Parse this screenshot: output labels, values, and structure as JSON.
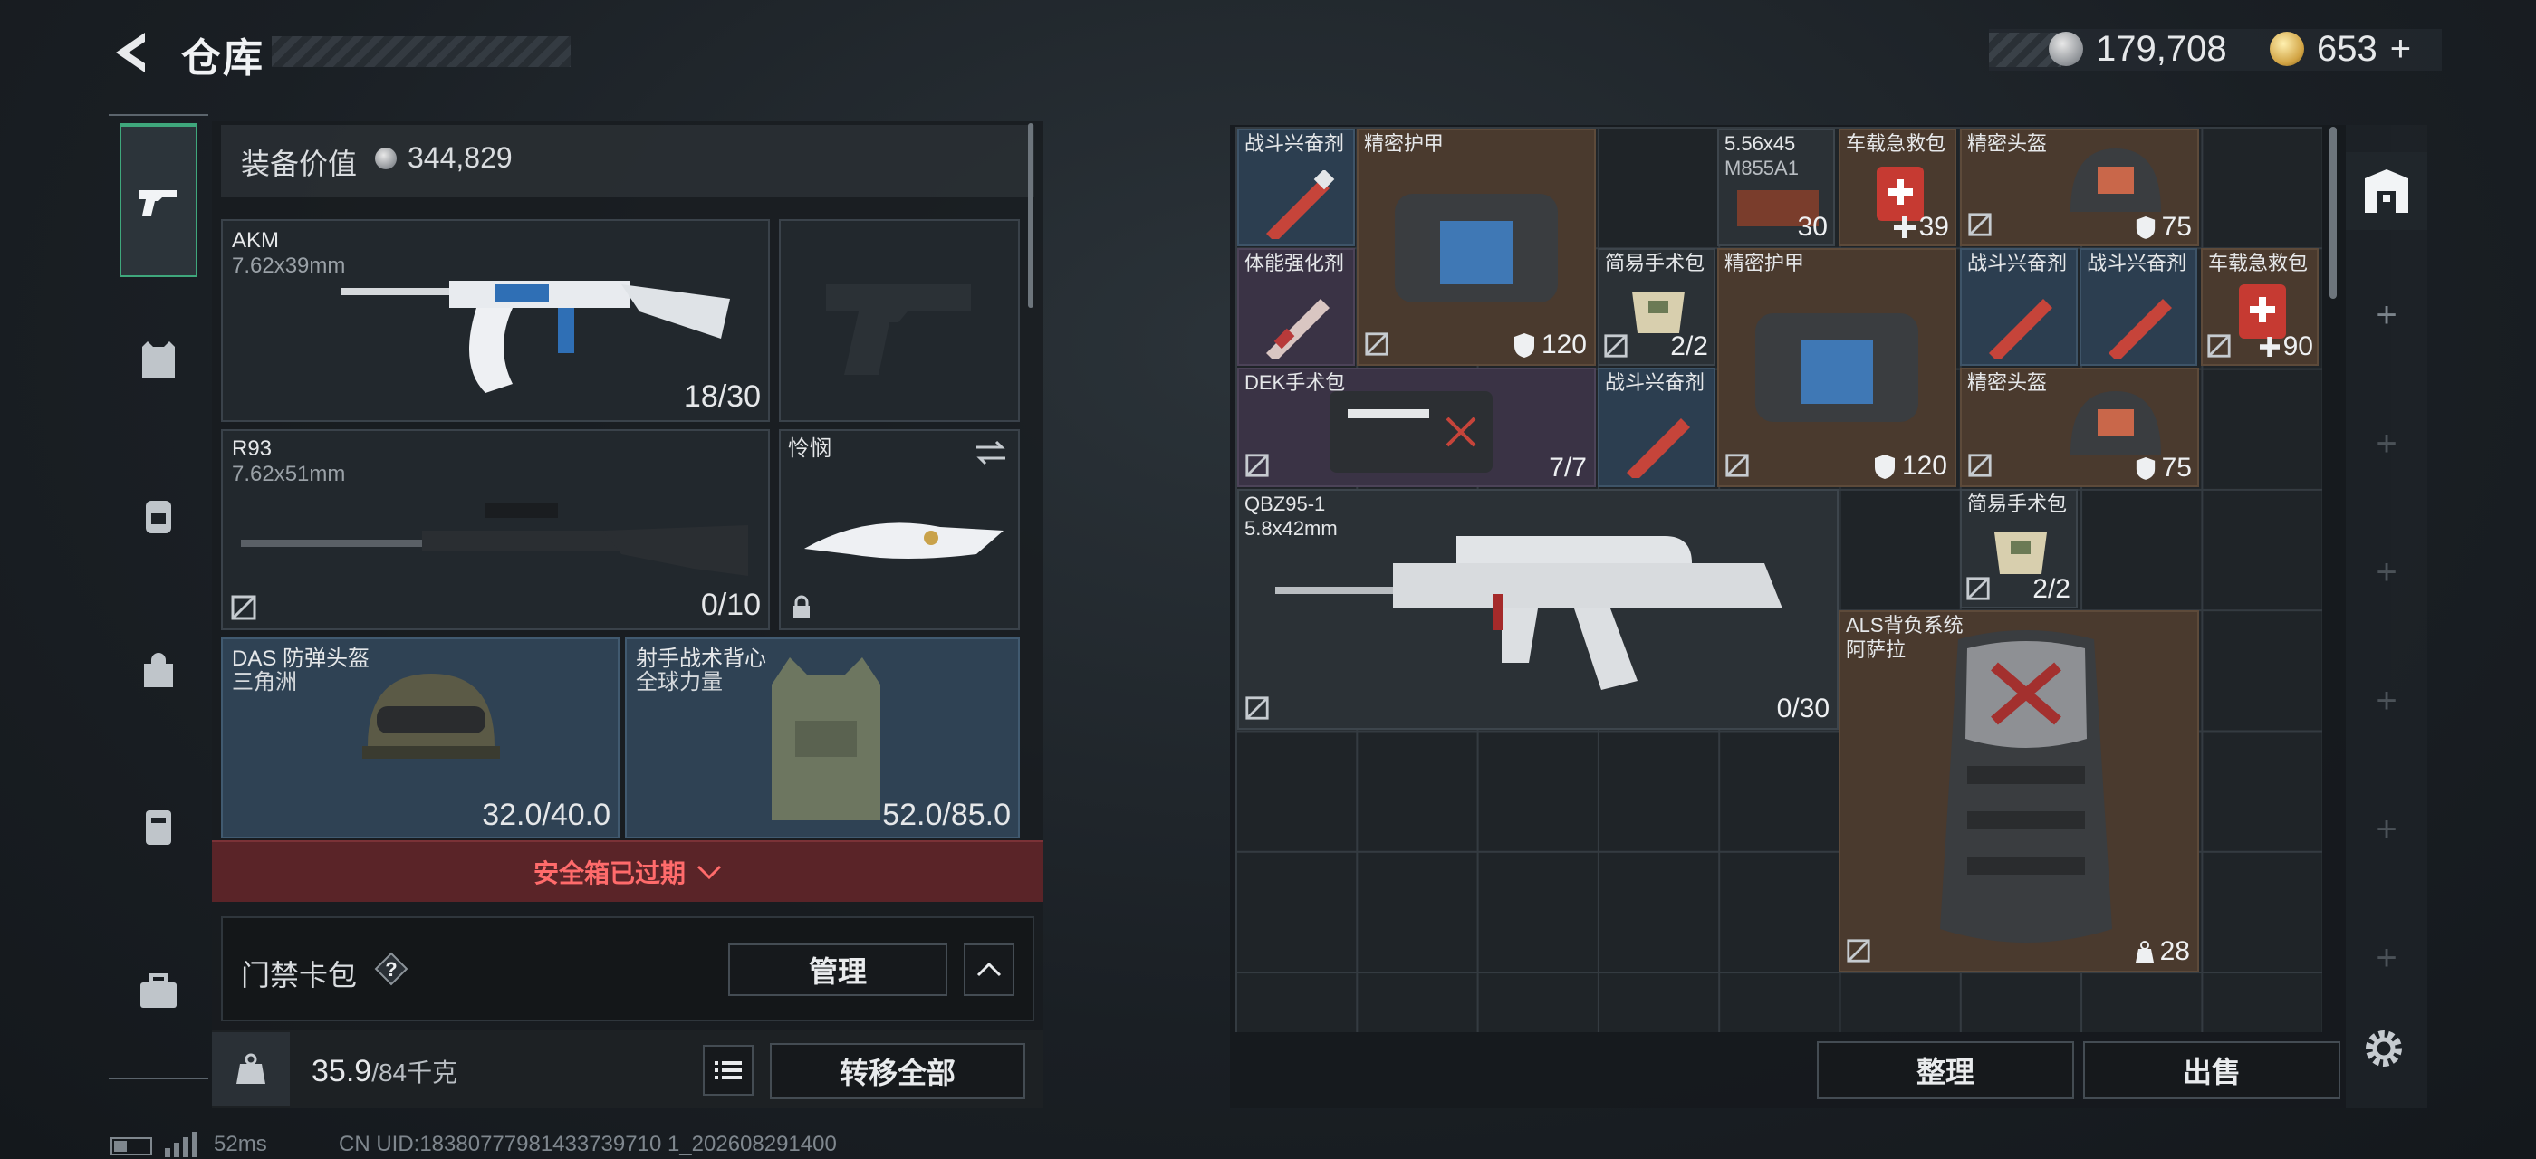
{
  "header": {
    "title": "仓库",
    "currency_silver": "179,708",
    "currency_gold": "653",
    "gold_plus": "+"
  },
  "equipment": {
    "value_label": "装备价值",
    "value": "344,829",
    "slots": [
      {
        "name": "AKM",
        "sub": "7.62x39mm",
        "count": "18/30"
      },
      {
        "name": "R93",
        "sub": "7.62x51mm",
        "count": "0/10"
      },
      {
        "name": "怜悯",
        "sub": "",
        "count": ""
      },
      {
        "name": "DAS 防弹头盔",
        "sub": "三角洲",
        "count": "32.0/40.0"
      },
      {
        "name": "射手战术背心",
        "sub": "全球力量",
        "count": "52.0/85.0"
      }
    ],
    "alert": "安全箱已过期",
    "keycard_label": "门禁卡包",
    "help": "?",
    "manage": "管理",
    "weight_current": "35.9",
    "weight_cap": "/84千克",
    "transfer_all": "转移全部"
  },
  "storage": {
    "items": [
      {
        "name": "战斗兴奋剂",
        "value": ""
      },
      {
        "name": "精密护甲",
        "value": "120"
      },
      {
        "name": "5.56x45",
        "sub": "M855A1",
        "value": "30"
      },
      {
        "name": "车载急救包",
        "value": "39"
      },
      {
        "name": "精密头盔",
        "value": "75"
      },
      {
        "name": "体能强化剂",
        "value": ""
      },
      {
        "name": "简易手术包",
        "value": "2/2"
      },
      {
        "name": "精密护甲",
        "value": "120"
      },
      {
        "name": "战斗兴奋剂",
        "value": ""
      },
      {
        "name": "战斗兴奋剂",
        "value": ""
      },
      {
        "name": "车载急救包",
        "value": "90"
      },
      {
        "name": "DEK手术包",
        "value": "7/7"
      },
      {
        "name": "战斗兴奋剂",
        "value": ""
      },
      {
        "name": "精密头盔",
        "value": "75"
      },
      {
        "name": "QBZ95-1",
        "sub": "5.8x42mm",
        "value": "0/30"
      },
      {
        "name": "简易手术包",
        "value": "2/2"
      },
      {
        "name": "ALS背负系统",
        "sub": "阿萨拉",
        "value": "28"
      }
    ],
    "sort": "整理",
    "sell": "出售"
  },
  "status_bar": {
    "ping": "52ms",
    "uid": "CN UID:18380777981433739710 1_202608291400"
  },
  "colors": {
    "accent_green": "#3fa77c",
    "alert_red": "#ff6b6b",
    "blue_rarity": "#2c3e50",
    "brown_rarity": "#4a3a2e",
    "purple_rarity": "#3a3345"
  }
}
